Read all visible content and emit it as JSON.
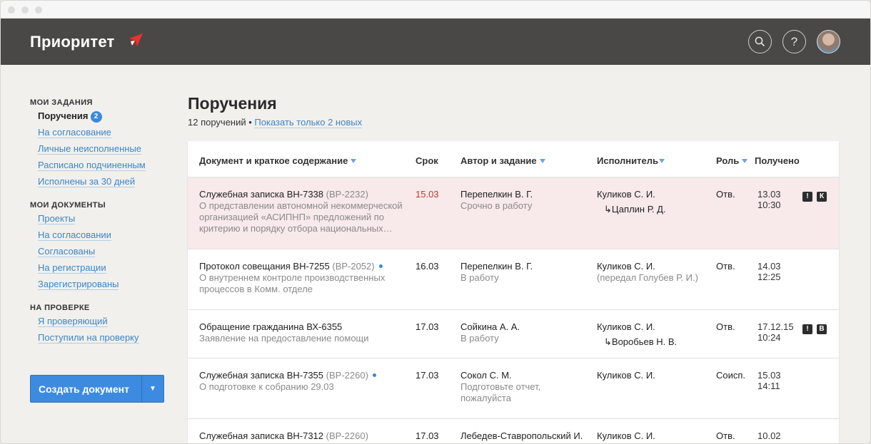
{
  "app": {
    "brand": "Приоритет"
  },
  "sidebar": {
    "sections": [
      {
        "title": "МОИ ЗАДАНИЯ",
        "items": [
          {
            "label": "Поручения",
            "active": true,
            "badge": "2"
          },
          {
            "label": "На согласование"
          },
          {
            "label": "Личные неисполненные"
          },
          {
            "label": "Расписано подчиненным"
          },
          {
            "label": "Исполнены за 30 дней"
          }
        ]
      },
      {
        "title": "МОИ ДОКУМЕНТЫ",
        "items": [
          {
            "label": "Проекты"
          },
          {
            "label": "На согласовании"
          },
          {
            "label": "Согласованы"
          },
          {
            "label": "На регистрации"
          },
          {
            "label": "Зарегистрированы"
          }
        ]
      },
      {
        "title": "НА ПРОВЕРКЕ",
        "items": [
          {
            "label": "Я проверяющий"
          },
          {
            "label": "Поступили на проверку"
          }
        ]
      }
    ],
    "create_button": "Создать документ"
  },
  "main": {
    "title": "Поручения",
    "count_text": "12 поручений",
    "separator": " • ",
    "show_new_link": "Показать только 2 новых"
  },
  "table": {
    "headers": {
      "doc": "Документ и краткое содержание",
      "due": "Срок",
      "author": "Автор и задание",
      "executor": "Исполнитель",
      "role": "Роль",
      "received": "Получено"
    },
    "rows": [
      {
        "title": "Служебная записка ВН-7338",
        "code": "(ВР-2232)",
        "is_new": false,
        "highlight": true,
        "summary": "О представлении автономной некоммерческой организацией «АСИПНП» предложений по критерию и порядку отбора национальных…",
        "due": "15.03",
        "due_overdue": true,
        "author": "Перепелкин В. Г.",
        "task": "Срочно в работу",
        "executor": "Куликов С. И.",
        "sub_executor": "Цаплин Р. Д.",
        "executor_note": "",
        "role": "Отв.",
        "received_date": "13.03",
        "received_time": "10:30",
        "flags": [
          "!",
          "К"
        ]
      },
      {
        "title": "Протокол совещания ВН-7255",
        "code": "(ВР-2052)",
        "is_new": true,
        "highlight": false,
        "summary": "О внутреннем контроле производственных процессов в Комм. отделе",
        "due": "16.03",
        "due_overdue": false,
        "author": "Перепелкин В. Г.",
        "task": "В работу",
        "executor": "Куликов С. И.",
        "sub_executor": "",
        "executor_note": "(передал Голубев Р. И.)",
        "role": "Отв.",
        "received_date": "14.03",
        "received_time": "12:25",
        "flags": []
      },
      {
        "title": "Обращение гражданина ВХ-6355",
        "code": "",
        "is_new": false,
        "highlight": false,
        "summary": "Заявление на предоставление помощи",
        "due": "17.03",
        "due_overdue": false,
        "author": "Сойкина А. А.",
        "task": "В работу",
        "executor": "Куликов С. И.",
        "sub_executor": "Воробьев Н. В.",
        "executor_note": "",
        "role": "Отв.",
        "received_date": "17.12.15",
        "received_time": "10:24",
        "flags": [
          "!",
          "В"
        ]
      },
      {
        "title": "Служебная записка ВН-7355",
        "code": "(ВР-2260)",
        "is_new": true,
        "highlight": false,
        "summary": "О подготовке к собранию 29.03",
        "due": "17.03",
        "due_overdue": false,
        "author": "Сокол С. М.",
        "task": "Подготовьте отчет, пожалуйста",
        "executor": "Куликов С. И.",
        "sub_executor": "",
        "executor_note": "",
        "role": "Соисп.",
        "received_date": "15.03",
        "received_time": "14:11",
        "flags": []
      },
      {
        "title": "Служебная записка ВН-7312",
        "code": "(ВР-2260)",
        "is_new": false,
        "highlight": false,
        "summary": "",
        "due": "17.03",
        "due_overdue": false,
        "author": "Лебедев-Ставропольский И.",
        "task": "",
        "executor": "Куликов С. И.",
        "sub_executor": "",
        "executor_note": "",
        "role": "Отв.",
        "received_date": "10.02",
        "received_time": "",
        "flags": []
      }
    ]
  }
}
